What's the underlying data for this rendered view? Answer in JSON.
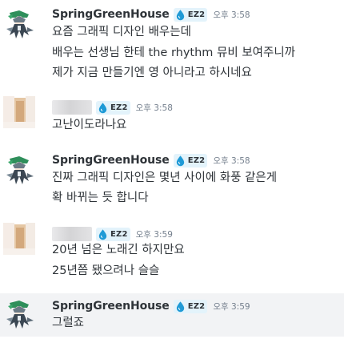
{
  "messages": [
    {
      "id": "m1",
      "author": "SpringGreenHouse",
      "tag": "EZ2",
      "time": "오후 3:58",
      "lines": [
        "요즘 그래픽 디자인 배우는데",
        "배우는 선생님 한테 the rhythm 뮤비 보여주니까",
        "제가 지금 만들기엔 영 아니라고 하시네요"
      ]
    },
    {
      "id": "m2",
      "author": "",
      "tag": "EZ2",
      "time": "오후 3:58",
      "lines": [
        "고난이도라나요"
      ]
    },
    {
      "id": "m3",
      "author": "SpringGreenHouse",
      "tag": "EZ2",
      "time": "오후 3:58",
      "lines": [
        "진짜 그래픽 디자인은 몇년 사이에 화풍 같은게",
        "확 바뀌는 듯 합니다"
      ]
    },
    {
      "id": "m4",
      "author": "",
      "tag": "EZ2",
      "time": "오후 3:59",
      "lines": [
        "20년 넘은 노래긴 하지만요",
        "25년쯤 됐으려나 슬슬"
      ]
    },
    {
      "id": "m5",
      "author": "SpringGreenHouse",
      "tag": "EZ2",
      "time": "오후 3:59",
      "lines": [
        "그럴죠"
      ]
    }
  ],
  "colors": {
    "username": "#2e3338",
    "timestamp": "#747f8d",
    "text": "#2e3338",
    "tag_bg": "#e3f3fb",
    "tag_icon": "#1f9ad6",
    "hover_bg": "#f2f3f5"
  },
  "icons": {
    "tag_icon": "water-drop-icon",
    "avatar_springgreenhouse": "anime-character-avatar",
    "avatar_blurred": "blurred-avatar"
  }
}
